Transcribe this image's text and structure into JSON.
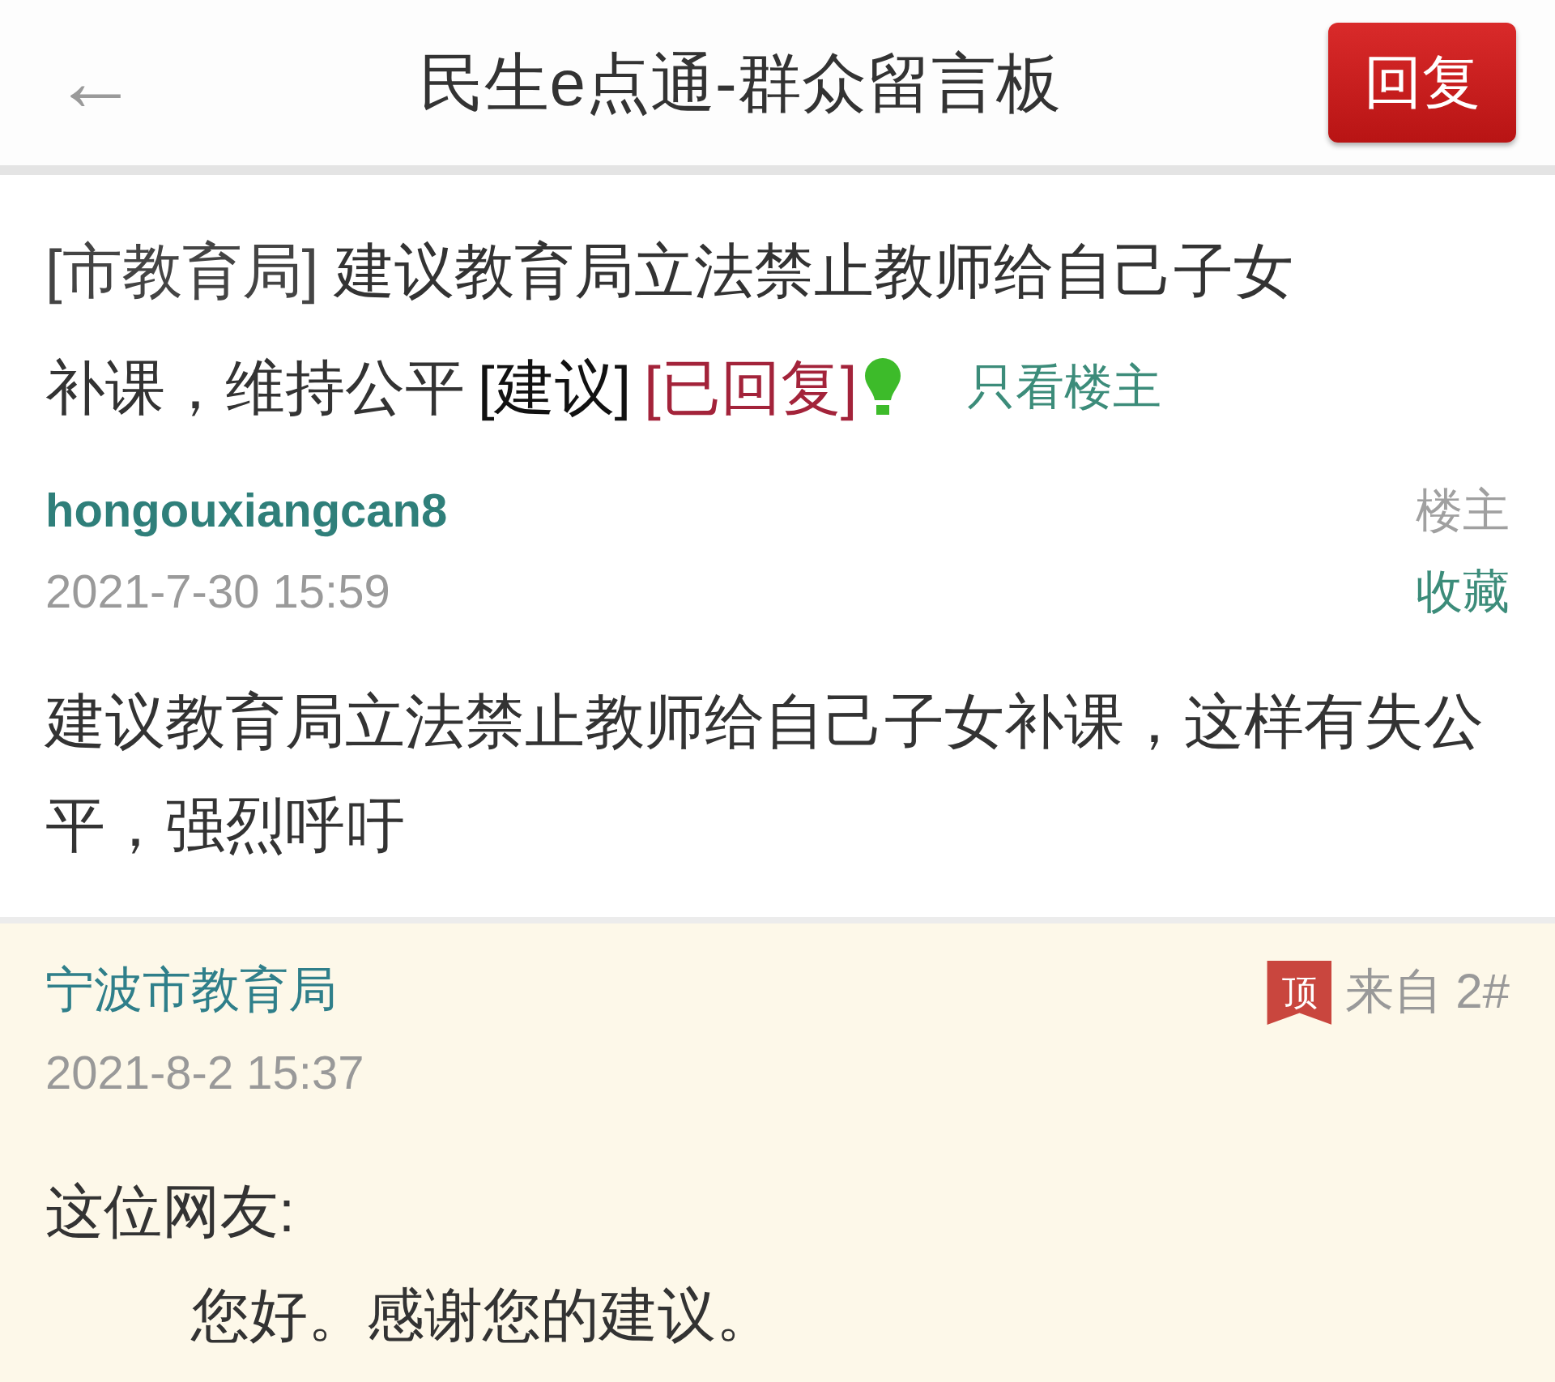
{
  "header": {
    "back": "←",
    "title": "民生e点通-群众留言板",
    "reply_button": "回复"
  },
  "post": {
    "category": "[市教育局]",
    "title": [
      "建议教育局立法禁止教师给自己子女",
      "补课，维持公平"
    ],
    "type": "[建议]",
    "status": "[已回复]",
    "owner_only_link": "只看楼主",
    "author": "hongouxiangcan8",
    "time": "2021-7-30 15:59",
    "owner_label": "楼主",
    "favorite_link": "收藏",
    "body": "建议教育局立法禁止教师给自己子女补课，这样有失公平，强烈呼吁"
  },
  "reply": {
    "author": "宁波市教育局",
    "time": "2021-8-2 15:37",
    "top_badge": "顶",
    "floor": "来自 2#",
    "greeting": "这位网友:",
    "body": "您好。感谢您的建议。"
  }
}
